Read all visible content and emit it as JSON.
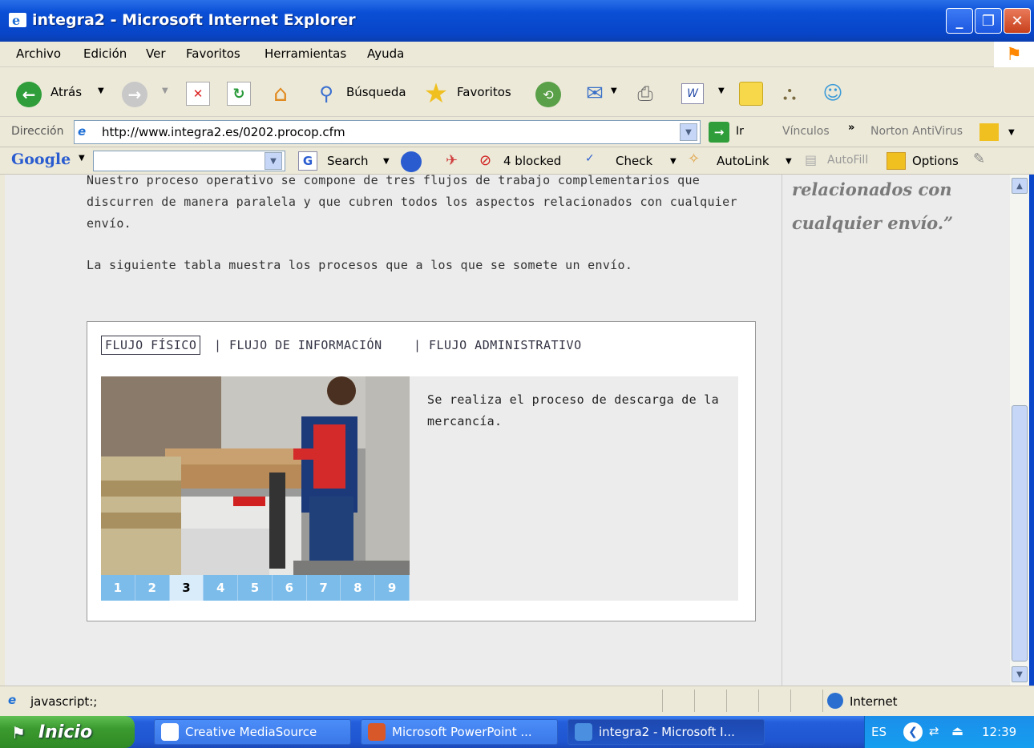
{
  "window": {
    "title": "integra2 - Microsoft Internet Explorer"
  },
  "menu": {
    "items": [
      "Archivo",
      "Edición",
      "Ver",
      "Favoritos",
      "Herramientas",
      "Ayuda"
    ]
  },
  "toolbar": {
    "back_label": "Atrás",
    "search_label": "Búsqueda",
    "favorites_label": "Favoritos"
  },
  "address": {
    "label": "Dirección",
    "url": "http://www.integra2.es/0202.procop.cfm",
    "go_label": "Ir",
    "links_label": "Vínculos",
    "norton_label": "Norton AntiVirus"
  },
  "google": {
    "logo": "Google",
    "search_label": "Search",
    "blocked_label": "4 blocked",
    "check_label": "Check",
    "autolink_label": "AutoLink",
    "autofill_label": "AutoFill",
    "options_label": "Options"
  },
  "content": {
    "intro_line1": "Nuestro proceso operativo se compone de tres flujos de trabajo complementarios que",
    "intro_line2": "discurren de manera paralela y que cubren todos los aspectos relacionados con cualquier",
    "intro_line3": "envío.",
    "table_intro": "La siguiente tabla muestra los procesos que a los que se somete un envío.",
    "tabs": [
      "FLUJO FÍSICO",
      "FLUJO DE INFORMACIÓN",
      "FLUJO ADMINISTRATIVO"
    ],
    "tab_separator": "|",
    "description_line1": "Se realiza el proceso de descarga de la",
    "description_line2": "mercancía.",
    "pager": [
      "1",
      "2",
      "3",
      "4",
      "5",
      "6",
      "7",
      "8",
      "9"
    ],
    "active_page": "3"
  },
  "sidebar": {
    "quote_line1": "relacionados con",
    "quote_line2": "cualquier envío.”"
  },
  "status": {
    "text": "javascript:;",
    "zone": "Internet"
  },
  "taskbar": {
    "start_label": "Inicio",
    "tasks": [
      "Creative MediaSource",
      "Microsoft PowerPoint ...",
      "integra2 - Microsoft I..."
    ],
    "lang": "ES",
    "clock": "12:39"
  }
}
